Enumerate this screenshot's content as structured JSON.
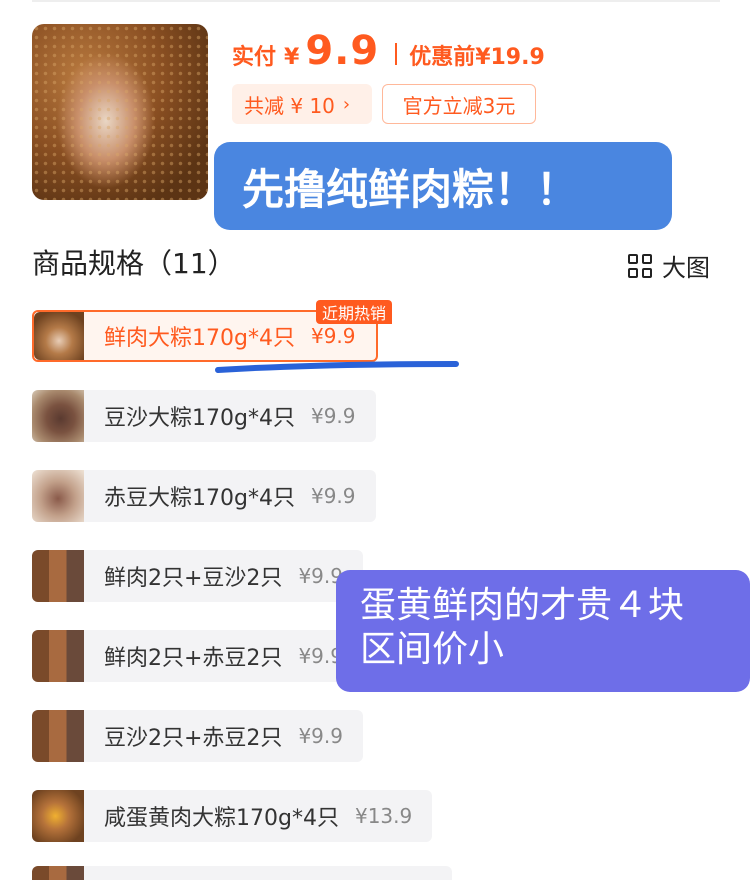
{
  "product": {
    "pay_label": "实付",
    "currency": "¥",
    "pay_amount": "9.9",
    "orig_label": "优惠前¥19.9",
    "discount_tag": "共减 ¥ 10",
    "discount_chevron": "›",
    "official_tag": "官方立减3元"
  },
  "annotations": {
    "note1": "先撸纯鲜肉粽！！",
    "note2_line1": "蛋黄鲜肉的才贵４块",
    "note2_line2": "区间价小"
  },
  "specs": {
    "title": "商品规格（11）",
    "view_label": "大图",
    "hot_badge": "近期热销",
    "items": [
      {
        "name": "鲜肉大粽170g*4只",
        "price": "¥9.9",
        "selected": true,
        "icon": "zongzi-meat-thumbnail"
      },
      {
        "name": "豆沙大粽170g*4只",
        "price": "¥9.9",
        "selected": false,
        "icon": "zongzi-bean-thumbnail"
      },
      {
        "name": "赤豆大粽170g*4只",
        "price": "¥9.9",
        "selected": false,
        "icon": "zongzi-redbean-thumbnail"
      },
      {
        "name": "鲜肉2只+豆沙2只",
        "price": "¥9.9",
        "selected": false,
        "icon": "zongzi-combo-thumbnail"
      },
      {
        "name": "鲜肉2只+赤豆2只",
        "price": "¥9.9",
        "selected": false,
        "icon": "zongzi-combo-thumbnail"
      },
      {
        "name": "豆沙2只+赤豆2只",
        "price": "¥9.9",
        "selected": false,
        "icon": "zongzi-combo-thumbnail"
      },
      {
        "name": "咸蛋黄肉大粽170g*4只",
        "price": "¥13.9",
        "selected": false,
        "icon": "zongzi-yolk-thumbnail"
      }
    ]
  },
  "colors": {
    "accent": "#ff5a1f",
    "note1_bg": "#4a86e0",
    "note2_bg": "#6e6ee8"
  }
}
